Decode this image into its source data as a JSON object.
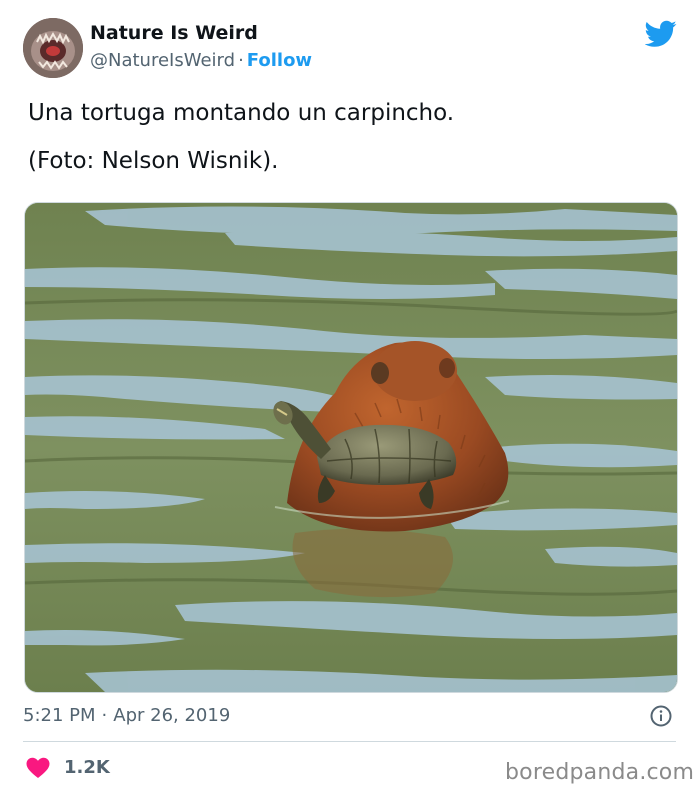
{
  "author": {
    "display_name": "Nature Is Weird",
    "handle": "@NatureIsWeird",
    "separator": "·",
    "follow_label": "Follow"
  },
  "tweet": {
    "text_line1": "Una tortuga montando un carpincho.",
    "text_line2": "(Foto: Nelson Wisnik)."
  },
  "meta": {
    "time": "5:21 PM",
    "separator": "·",
    "date": "Apr 26, 2019"
  },
  "engagement": {
    "likes": "1.2K"
  },
  "watermark": "boredpanda.com",
  "icons": {
    "brand": "twitter-bird-icon",
    "info": "info-icon",
    "like": "heart-icon"
  },
  "colors": {
    "accent": "#1d9bf0",
    "like": "#f91880",
    "muted_text": "#536471",
    "water": "#7c8f5a",
    "capybara": "#a0522d"
  }
}
